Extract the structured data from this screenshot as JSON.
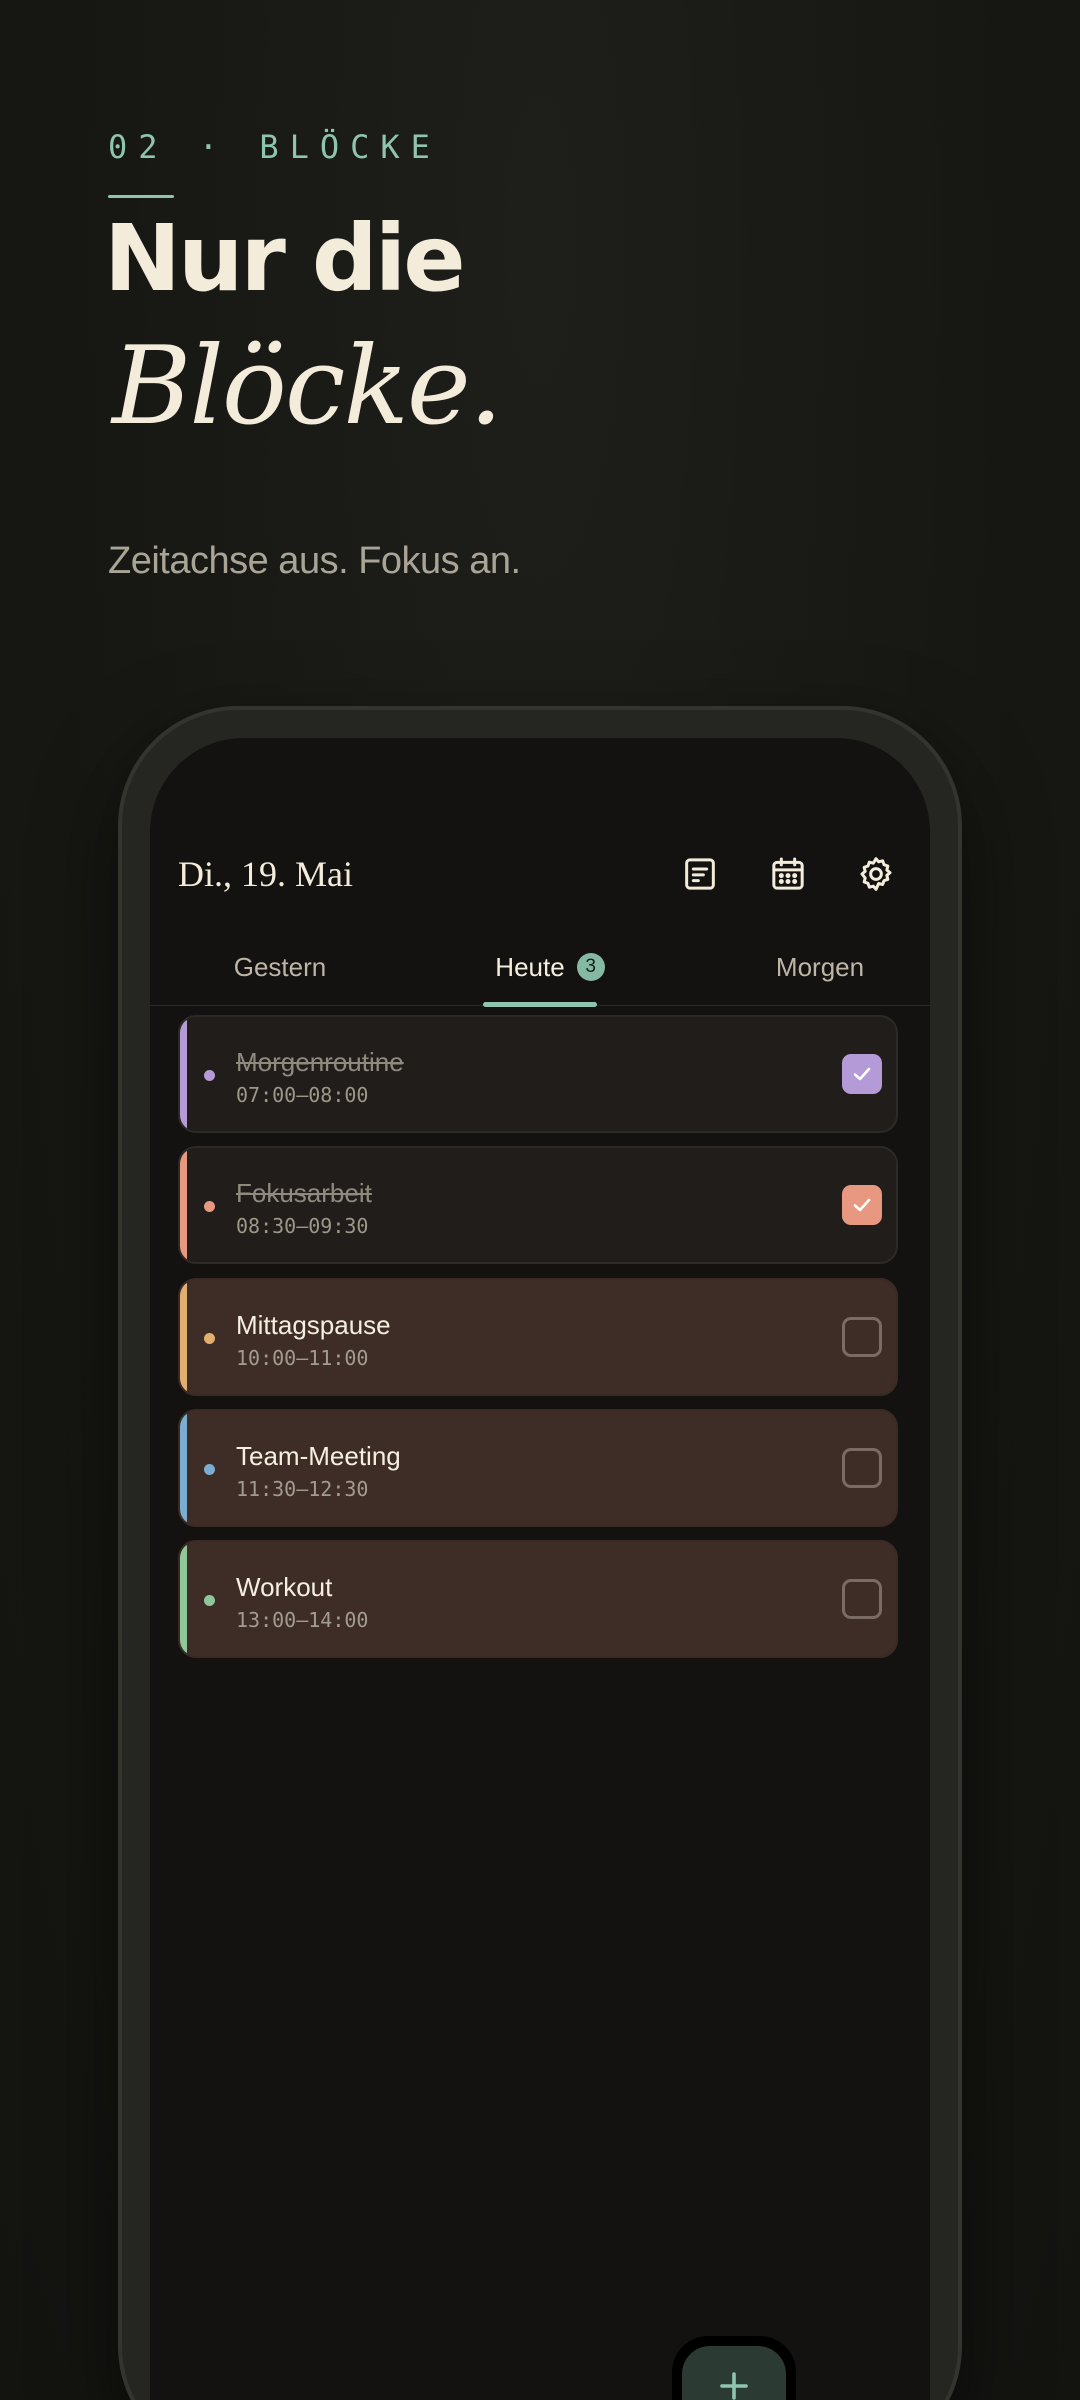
{
  "hero": {
    "eyebrow": "02 · BLÖCKE",
    "headline_line1": "Nur die",
    "headline_line2": "Blöcke.",
    "tagline": "Zeitachse aus. Fokus an."
  },
  "app": {
    "date_title": "Di., 19. Mai",
    "toolbar_icons": [
      "notes-icon",
      "calendar-icon",
      "settings-icon"
    ],
    "tabs": [
      {
        "label": "Gestern",
        "active": false
      },
      {
        "label": "Heute",
        "active": true,
        "badge": "3"
      },
      {
        "label": "Morgen",
        "active": false
      }
    ],
    "tasks": [
      {
        "title": "Morgenroutine",
        "time": "07:00–08:00",
        "done": true,
        "color": "#b49ad6"
      },
      {
        "title": "Fokusarbeit",
        "time": "08:30–09:30",
        "done": true,
        "color": "#e89880"
      },
      {
        "title": "Mittagspause",
        "time": "10:00–11:00",
        "done": false,
        "color": "#e0b070"
      },
      {
        "title": "Team-Meeting",
        "time": "11:30–12:30",
        "done": false,
        "color": "#7aaed0"
      },
      {
        "title": "Workout",
        "time": "13:00–14:00",
        "done": false,
        "color": "#8fc79a"
      }
    ],
    "fab_icon": "plus-icon"
  },
  "colors": {
    "accent": "#8fc4ae",
    "background": "#171713",
    "text": "#f3ecdb"
  }
}
